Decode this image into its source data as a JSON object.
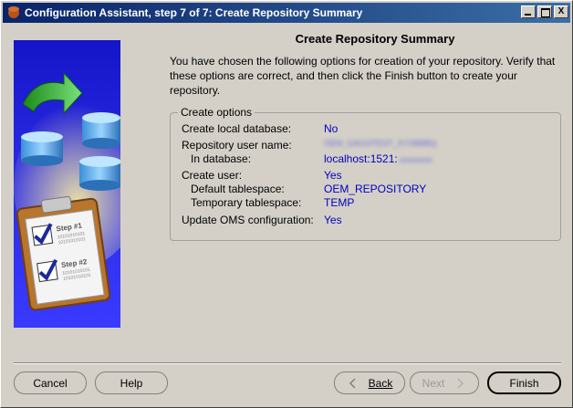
{
  "window": {
    "title": "Configuration Assistant, step 7 of 7: Create Repository Summary",
    "controls": {
      "minimize": "",
      "maximize": "",
      "close": "X"
    }
  },
  "main": {
    "title": "Create Repository Summary",
    "intro": "You have chosen the following options for creation of your repository.  Verify that these options are correct, and then click the Finish button to create your repository."
  },
  "options": {
    "legend": "Create options",
    "rows": [
      {
        "label": "Create local database:",
        "value": "No"
      },
      {
        "label": "Repository user name:",
        "value": "OEM_GAGOTEST_XYXBBBQ"
      },
      {
        "label": "In database:",
        "value": "localhost:1521:",
        "value_suffix": "xxxxxxxx"
      },
      {
        "label": "Create user:",
        "value": "Yes"
      },
      {
        "label": "Default tablespace:",
        "value": "OEM_REPOSITORY"
      },
      {
        "label": "Temporary tablespace:",
        "value": "TEMP"
      },
      {
        "label": "Update OMS configuration:",
        "value": "Yes"
      }
    ]
  },
  "illustration": {
    "step1": "Step #1",
    "step2": "Step #2",
    "binary": "10101010101"
  },
  "buttons": {
    "cancel": "Cancel",
    "help": "Help",
    "back": "Back",
    "next": "Next",
    "finish": "Finish"
  },
  "icons": {
    "app": "config-assistant-icon",
    "back": "chevron-left-icon",
    "next": "chevron-right-icon"
  }
}
